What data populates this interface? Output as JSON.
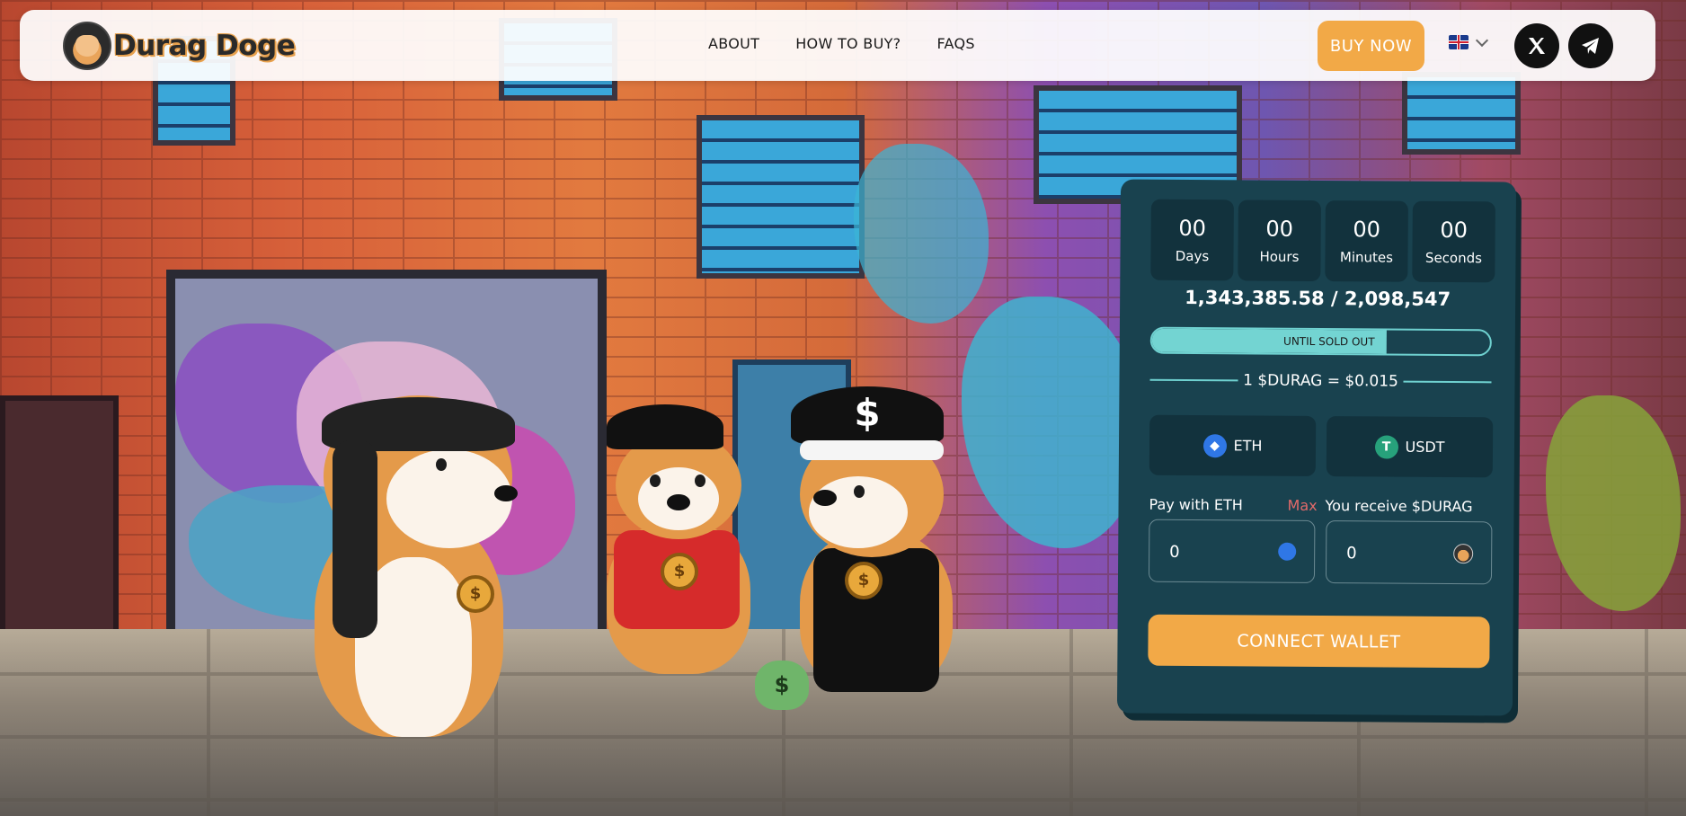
{
  "brand": {
    "name": "Durag Doge"
  },
  "nav": {
    "items": [
      "ABOUT",
      "HOW TO BUY?",
      "FAQS"
    ]
  },
  "header": {
    "buy_now_label": "BUY NOW",
    "language": "en-GB"
  },
  "icons": {
    "logo": "doge-logo-icon",
    "language_flag": "uk-flag-icon",
    "language_chevron": "chevron-down-icon",
    "twitter": "x-logo-icon",
    "telegram": "telegram-icon",
    "eth": "ethereum-icon",
    "usdt": "tether-icon",
    "durag": "durag-token-icon"
  },
  "countdown": {
    "days": {
      "value": "00",
      "label": "Days"
    },
    "hours": {
      "value": "00",
      "label": "Hours"
    },
    "minutes": {
      "value": "00",
      "label": "Minutes"
    },
    "seconds": {
      "value": "00",
      "label": "Seconds"
    }
  },
  "presale": {
    "raised_text": "1,343,385.58 / 2,098,547",
    "progress_fraction": 0.695,
    "progress_label": "UNTIL SOLD OUT",
    "rate_text": "1 $DURAG = $0.015",
    "tokens": [
      {
        "label": "ETH"
      },
      {
        "label": "USDT"
      }
    ],
    "pay_label": "Pay with ETH",
    "max_label": "Max",
    "receive_label": "You receive $DURAG",
    "pay_value": "0",
    "receive_value": "0",
    "connect_label": "CONNECT WALLET"
  },
  "colors": {
    "accent_orange": "#f2a947",
    "widget_bg": "#19424f",
    "widget_inner": "#12323d",
    "progress_teal": "#73d4d2",
    "max_red": "#e26a6a"
  }
}
